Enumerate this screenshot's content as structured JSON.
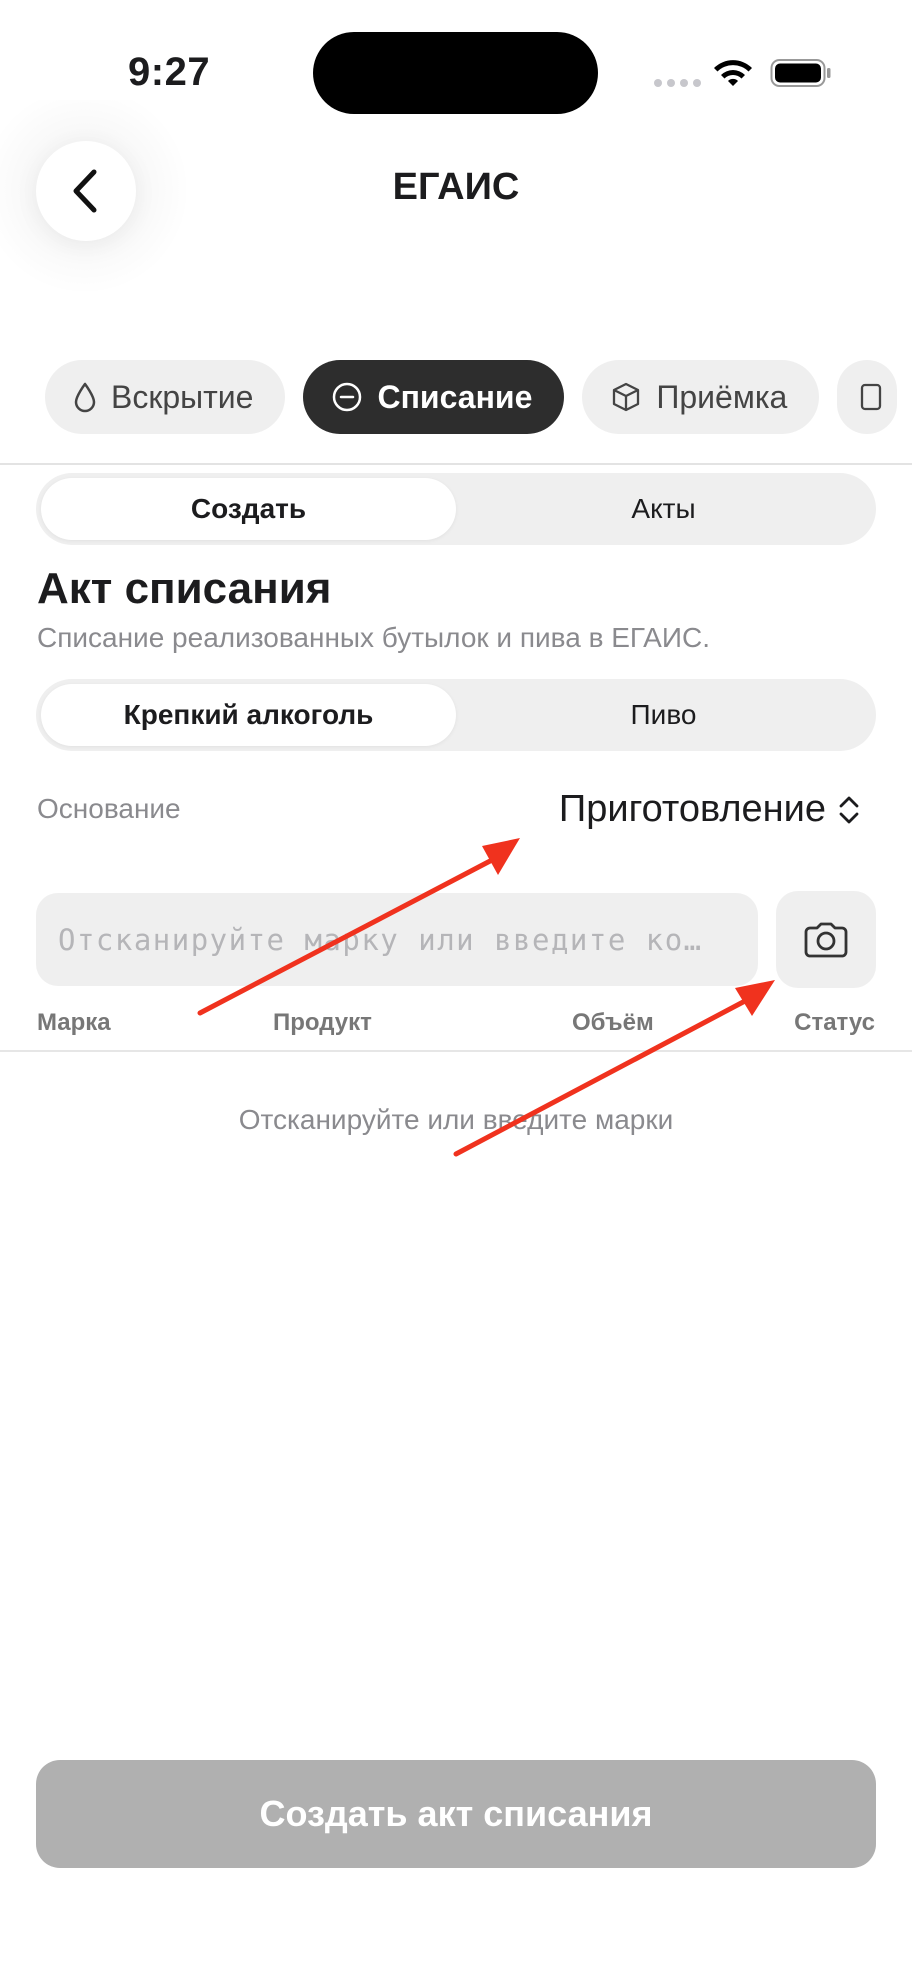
{
  "status_bar": {
    "time": "9:27",
    "icons": [
      "cellular-dots-icon",
      "wifi-icon",
      "battery-icon"
    ]
  },
  "header": {
    "title": "ЕГАИС",
    "back_icon": "chevron-left-icon"
  },
  "categories": [
    {
      "label": "Вскрытие",
      "icon": "drop-icon",
      "active": false
    },
    {
      "label": "Списание",
      "icon": "minus-circle-icon",
      "active": true
    },
    {
      "label": "Приёмка",
      "icon": "box-icon",
      "active": false
    }
  ],
  "mode_tabs": [
    {
      "label": "Создать",
      "active": true
    },
    {
      "label": "Акты",
      "active": false
    }
  ],
  "act": {
    "title": "Акт списания",
    "subtitle": "Списание реализованных бутылок и пива в ЕГАИС."
  },
  "type_tabs": [
    {
      "label": "Крепкий алкоголь",
      "active": true
    },
    {
      "label": "Пиво",
      "active": false
    }
  ],
  "basis": {
    "label": "Основание",
    "value": "Приготовление",
    "icon": "chevron-up-down-icon"
  },
  "scan": {
    "placeholder": "Отсканируйте марку или введите ко…",
    "value": "",
    "camera_icon": "camera-icon"
  },
  "table": {
    "columns": [
      "Марка",
      "Продукт",
      "Объём",
      "Статус"
    ],
    "empty_message": "Отсканируйте или введите марки"
  },
  "submit": {
    "label": "Создать акт списания"
  },
  "colors": {
    "active_chip": "#2d2d2d",
    "disabled_button": "#b0b0b0",
    "annotation_arrow": "#f0321e"
  }
}
